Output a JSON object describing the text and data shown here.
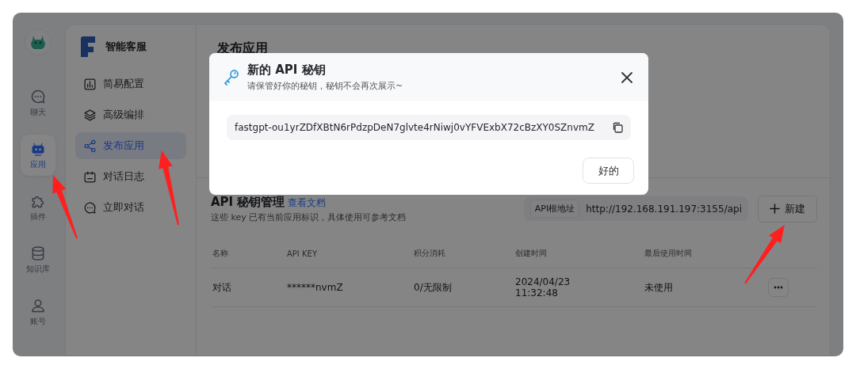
{
  "nav_rail": {
    "items": [
      {
        "label": "聊天",
        "kind": "chat",
        "selected": false
      },
      {
        "label": "应用",
        "kind": "robot",
        "selected": true
      },
      {
        "label": "插件",
        "kind": "puzzle",
        "selected": false
      },
      {
        "label": "知识库",
        "kind": "database",
        "selected": false
      },
      {
        "label": "账号",
        "kind": "user",
        "selected": false
      }
    ]
  },
  "app": {
    "name": "智能客服"
  },
  "sidebar": {
    "items": [
      {
        "label": "简易配置",
        "kind": "chart",
        "selected": false
      },
      {
        "label": "高级编排",
        "kind": "layers",
        "selected": false
      },
      {
        "label": "发布应用",
        "kind": "share",
        "selected": true
      },
      {
        "label": "对话日志",
        "kind": "calendar",
        "selected": false
      },
      {
        "label": "立即对话",
        "kind": "chat",
        "selected": false
      }
    ]
  },
  "page_title": "发布应用",
  "api_keys": {
    "title": "API 秘钥管理",
    "doc_link": "查看文档",
    "subtitle": "这些 key 已有当前应用标识，具体使用可参考文档",
    "base_url_label": "API根地址",
    "base_url": "http://192.168.191.197:3155/api",
    "new_button": "新建",
    "columns": [
      "名称",
      "API KEY",
      "积分消耗",
      "创建时间",
      "最后使用时间"
    ],
    "rows": [
      {
        "name": "对话",
        "api_key": "******nvmZ",
        "usage": "0/无限制",
        "created": "2024/04/23 11:32:48",
        "last_used": "未使用"
      }
    ]
  },
  "dialog": {
    "title": "新的 API 秘钥",
    "subtitle": "请保管好你的秘钥，秘钥不会再次展示~",
    "key": "fastgpt-ou1yrZDfXBtN6rPdzpDeN7glvte4rNiwj0vYFVExbX72cBzXY0SZnvmZ",
    "confirm_button": "好的"
  }
}
